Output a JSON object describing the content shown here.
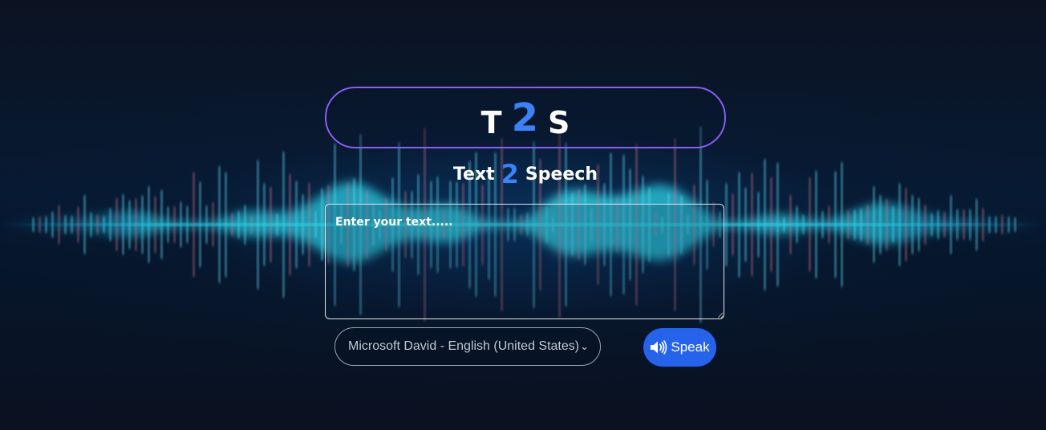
{
  "title": {
    "left": "T",
    "middle": "2",
    "right": "S"
  },
  "subtitle": {
    "word1": "Text",
    "middle": "2",
    "word2": "Speech"
  },
  "input": {
    "placeholder": "Enter your text.....",
    "value": ""
  },
  "voice_select": {
    "selected": "Microsoft David - English (United States)"
  },
  "speak_button": {
    "label": "Speak",
    "icon": "speaker-icon"
  },
  "colors": {
    "accent_blue": "#3b82f6",
    "button_blue": "#2563eb",
    "title_border": "#8b5cf6",
    "subtitle_bar": "#e11d74",
    "background": "#0a1120"
  },
  "background_image": "sound-wave-visualization"
}
